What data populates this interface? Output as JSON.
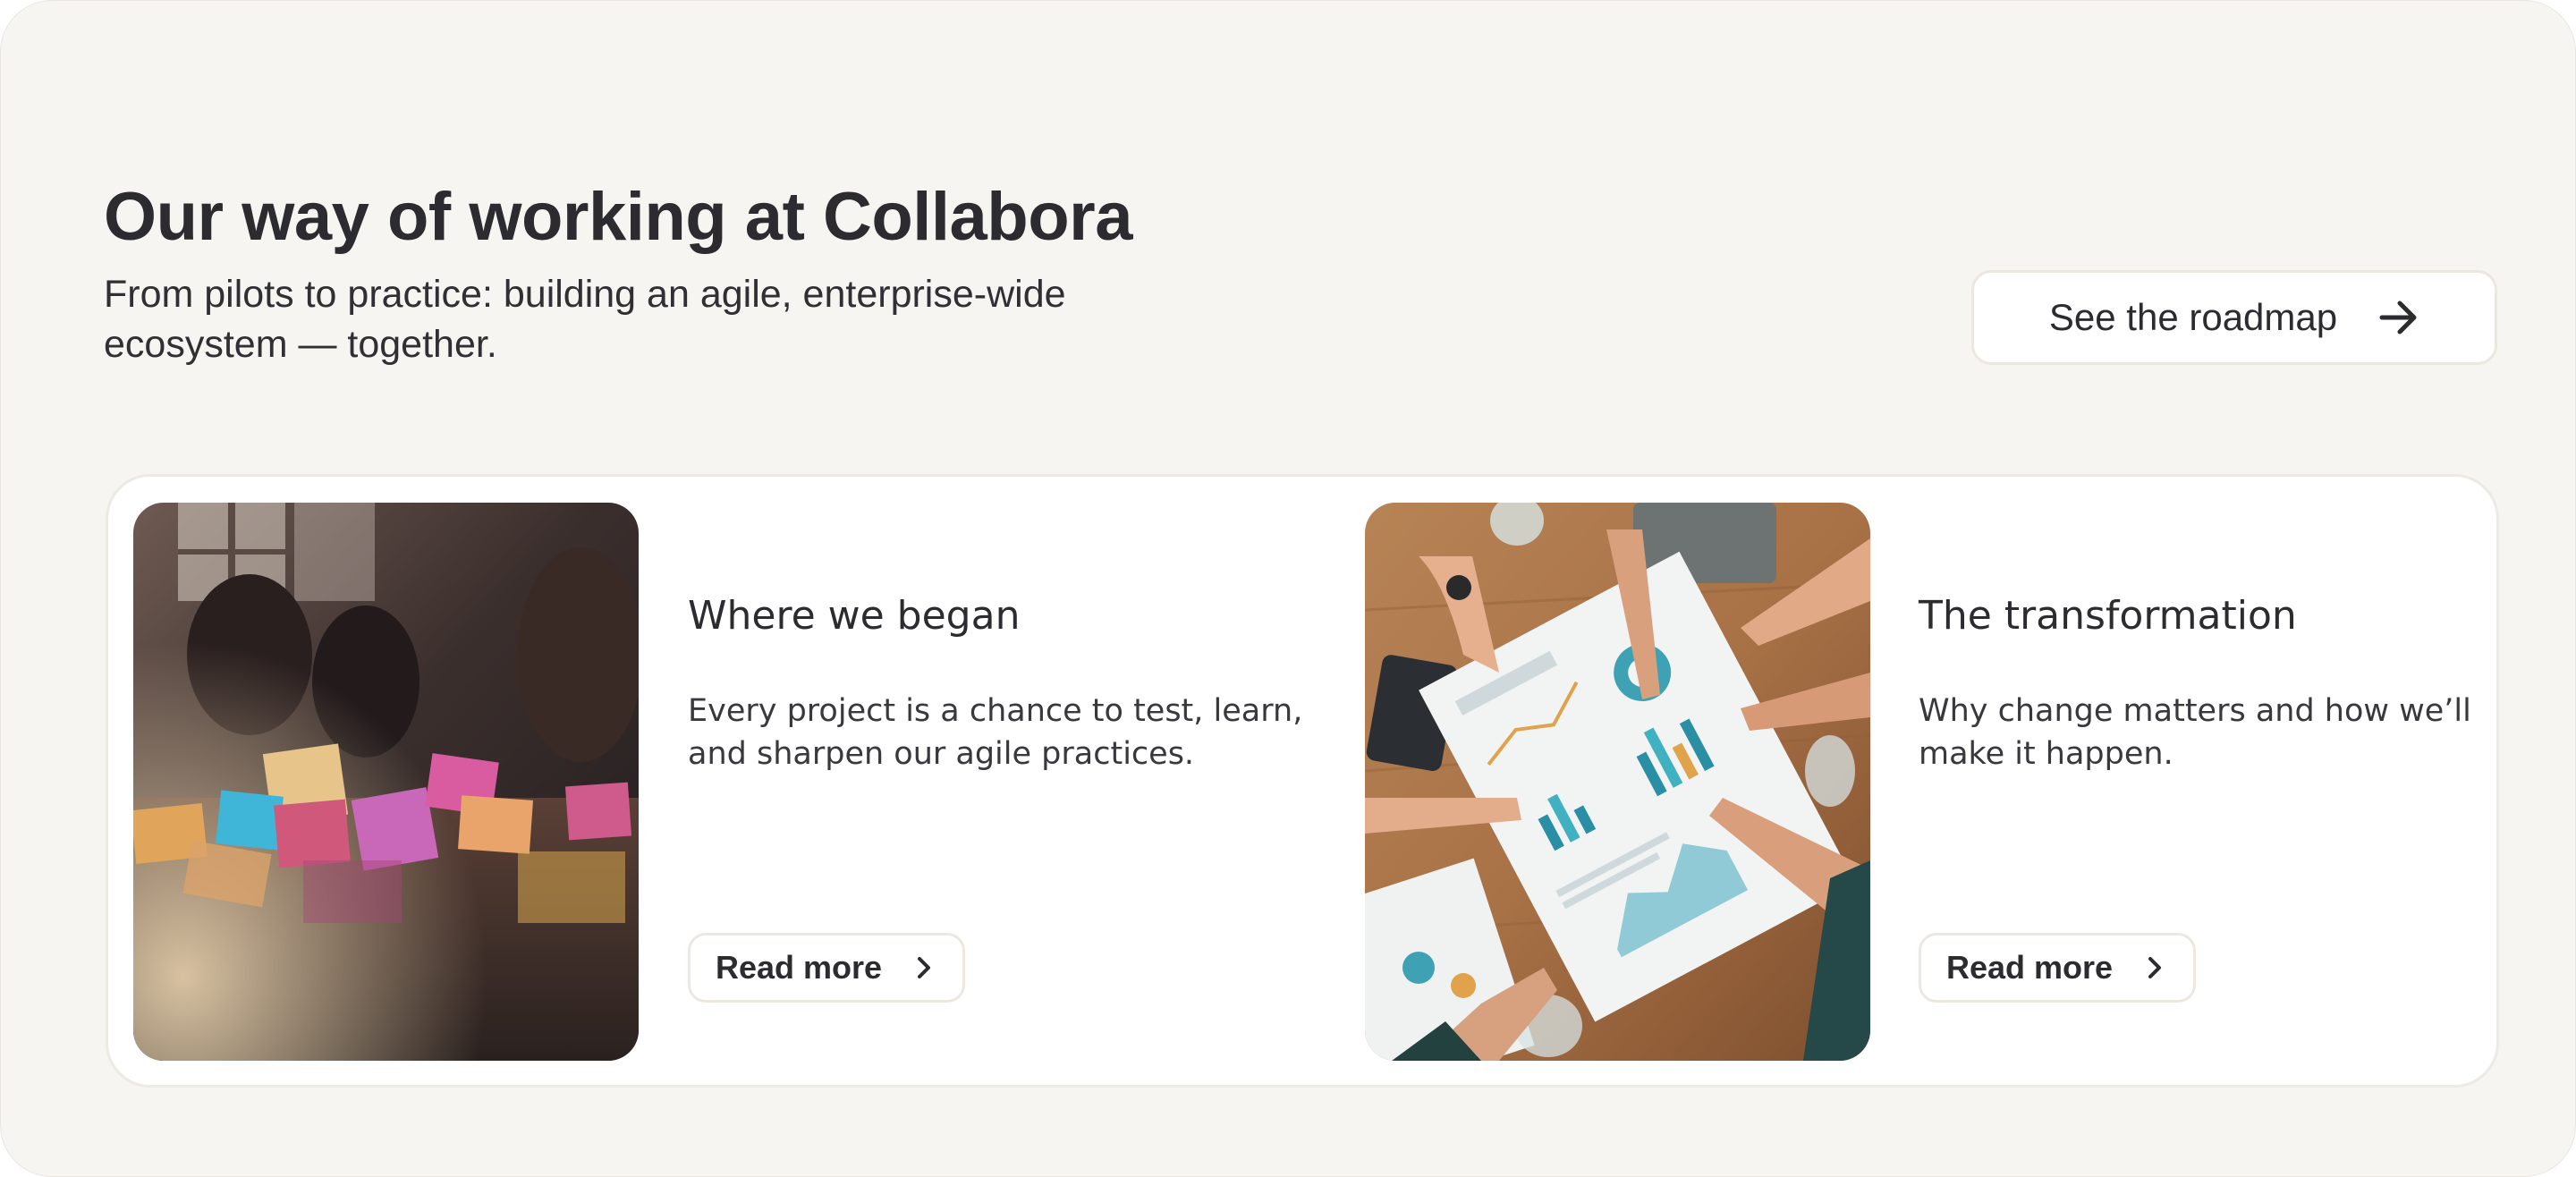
{
  "hero": {
    "title": "Our way of working at Collabora",
    "subtitle": "From pilots to practice: building an agile, enterprise-wide ecosystem — together.",
    "cta_label": "See the roadmap",
    "cta_icon": "arrow-right-icon"
  },
  "cards": [
    {
      "image": "sticky-notes-meeting-photo",
      "title": "Where we began",
      "text": "Every project is a chance to test, learn, and sharpen our agile practices.",
      "button_label": "Read more",
      "button_icon": "chevron-right-icon"
    },
    {
      "image": "team-reviewing-charts-photo",
      "title": "The transformation",
      "text": "Why change matters and how we’ll make it happen.",
      "button_label": "Read more",
      "button_icon": "chevron-right-icon"
    }
  ],
  "colors": {
    "page_background": "#f6f5f2",
    "panel_background": "#ffffff",
    "text": "#2b2b30",
    "border": "#ece8df"
  }
}
